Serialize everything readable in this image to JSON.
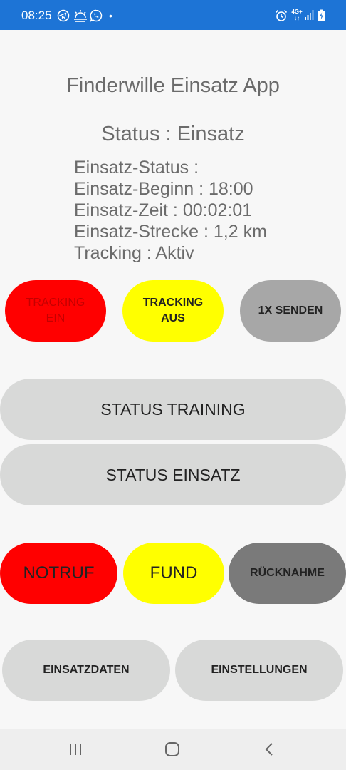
{
  "statusbar": {
    "time": "08:25",
    "network": "4G+",
    "icons": [
      "telegram-icon",
      "weather-icon",
      "whatsapp-icon",
      "dot-icon",
      "alarm-icon",
      "network-icon",
      "signal-icon",
      "battery-icon"
    ]
  },
  "app": {
    "title": "Finderwille Einsatz App"
  },
  "status": {
    "title": "Status : Einsatz"
  },
  "info": {
    "line1": "Einsatz-Status :",
    "line2": "Einsatz-Beginn : 18:00",
    "line3": "Einsatz-Zeit : 00:02:01",
    "line4": "Einsatz-Strecke : 1,2 km",
    "line5": "Tracking : Aktiv"
  },
  "buttons": {
    "tracking_on": "TRACKING EIN",
    "tracking_off": "TRACKING AUS",
    "send_once": "1X SENDEN",
    "status_training": "STATUS TRAINING",
    "status_einsatz": "STATUS EINSATZ",
    "notruf": "NOTRUF",
    "fund": "FUND",
    "ruecknahme": "RÜCKNAHME",
    "einsatzdaten": "EINSATZDATEN",
    "einstellungen": "EINSTELLUNGEN"
  },
  "colors": {
    "statusbar": "#1d74d6",
    "red": "#ff0000",
    "yellow": "#ffff00",
    "gray_light": "#d8d9d8",
    "gray_mid": "#a7a7a7",
    "gray_dark": "#7a7a7a",
    "text": "#6b6b6b"
  },
  "navbar": {
    "icons": [
      "recent-apps-icon",
      "home-icon",
      "back-icon"
    ]
  }
}
